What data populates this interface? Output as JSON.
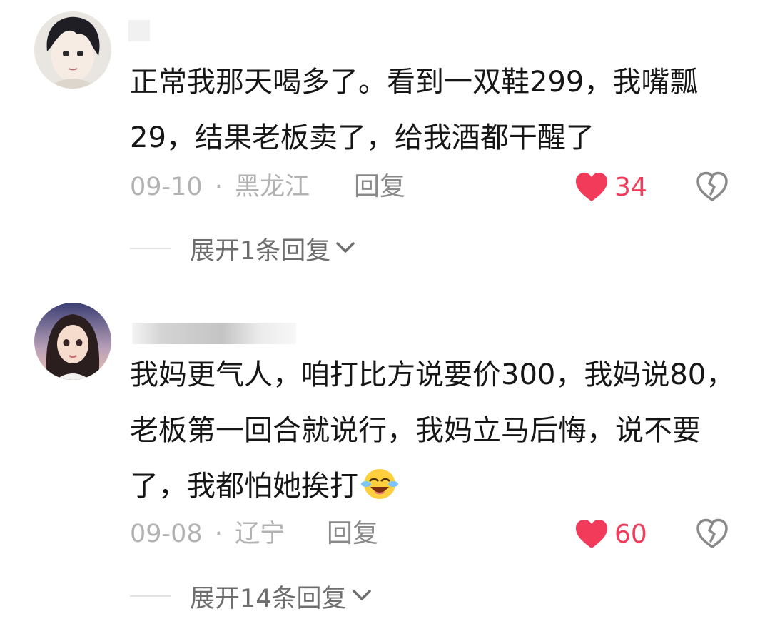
{
  "comments": [
    {
      "text": "正常我那天喝多了。看到一双鞋299，我嘴瓢29，结果老板卖了，给我酒都干醒了",
      "date": "09-10",
      "location": "黑龙江",
      "reply_label": "回复",
      "likes": "34",
      "expand_label": "展开1条回复",
      "icons": {
        "like": "heart-icon",
        "dislike": "broken-heart-icon",
        "expand": "chevron-down-icon"
      }
    },
    {
      "text": "我妈更气人，咱打比方说要价300，我妈说80，老板第一回合就说行，我妈立马后悔，说不要了，我都怕她挨打",
      "date": "09-08",
      "location": "辽宁",
      "reply_label": "回复",
      "likes": "60",
      "expand_label": "展开14条回复",
      "emoji": "crying-laughing-emoji",
      "icons": {
        "like": "heart-icon",
        "dislike": "broken-heart-icon",
        "expand": "chevron-down-icon"
      }
    }
  ],
  "separator": "·",
  "colors": {
    "like": "#f23a5a",
    "text": "#161616",
    "meta": "#b2b2b2"
  }
}
